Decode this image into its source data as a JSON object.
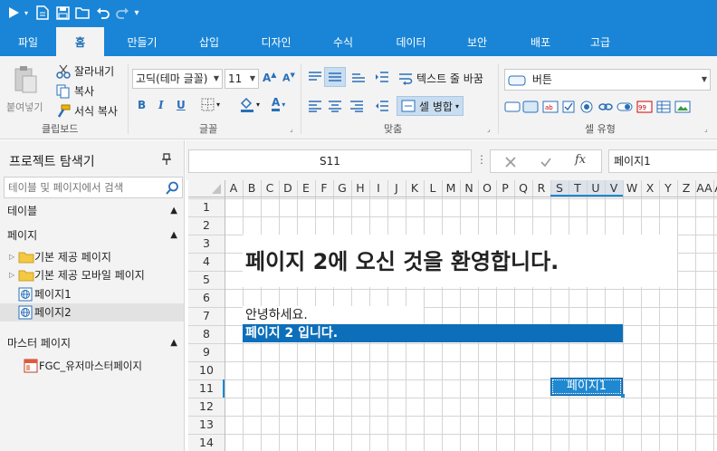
{
  "ribbon": {
    "tabs": [
      {
        "label": "파일",
        "active": false
      },
      {
        "label": "홈",
        "active": true
      },
      {
        "label": "만들기",
        "active": false
      },
      {
        "label": "삽입",
        "active": false
      },
      {
        "label": "디자인",
        "active": false
      },
      {
        "label": "수식",
        "active": false
      },
      {
        "label": "데이터",
        "active": false
      },
      {
        "label": "보안",
        "active": false
      },
      {
        "label": "배포",
        "active": false
      },
      {
        "label": "고급",
        "active": false
      }
    ],
    "clipboard": {
      "label": "클립보드",
      "paste": "붙여넣기",
      "cut": "잘라내기",
      "copy": "복사",
      "format_copy": "서식 복사"
    },
    "font": {
      "label": "글꼴",
      "family": "고딕(테마 글꼴)",
      "size": "11"
    },
    "alignment": {
      "label": "맞춤",
      "wrap_text": "텍스트 줄 바꿈",
      "merge_cells": "셀 병합"
    },
    "cell_type": {
      "label": "셀 유형",
      "value": "버튼"
    }
  },
  "explorer": {
    "title": "프로젝트 탐색기",
    "search_placeholder": "테이블 및 페이지에서 검색",
    "tables_section": "테이블",
    "pages_section": "페이지",
    "tree": [
      {
        "label": "기본 제공 페이지",
        "type": "folder",
        "selected": false
      },
      {
        "label": "기본 제공 모바일 페이지",
        "type": "folder",
        "selected": false
      },
      {
        "label": "페이지1",
        "type": "page",
        "selected": false
      },
      {
        "label": "페이지2",
        "type": "page",
        "selected": true
      }
    ],
    "master_section": "마스터 페이지",
    "master_items": [
      {
        "label": "FGC_유저마스터페이지"
      }
    ]
  },
  "formula_bar": {
    "cell_ref": "S11",
    "formula": "페이지1"
  },
  "grid": {
    "columns": [
      "A",
      "B",
      "C",
      "D",
      "E",
      "F",
      "G",
      "H",
      "I",
      "J",
      "K",
      "L",
      "M",
      "N",
      "O",
      "P",
      "Q",
      "R",
      "S",
      "T",
      "U",
      "V",
      "W",
      "X",
      "Y",
      "Z",
      "AA",
      "AA"
    ],
    "rows": [
      "1",
      "2",
      "3",
      "4",
      "5",
      "6",
      "7",
      "8",
      "9",
      "10",
      "11",
      "12",
      "13",
      "14"
    ],
    "selected_columns": [
      "S",
      "T",
      "U",
      "V"
    ],
    "selected_row": "11"
  },
  "cells": {
    "title": "페이지 2에 오신 것을 환영합니다.",
    "greeting": "안녕하세요.",
    "banner": "페이지 2 입니다.",
    "button": "페이지1"
  },
  "colors": {
    "accent": "#1a85d6",
    "banner": "#0d6fba",
    "button": "#1f88d1"
  }
}
